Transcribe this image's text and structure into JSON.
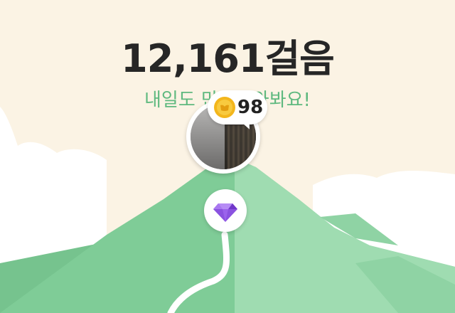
{
  "summary": {
    "steps_label": "12,161걸음",
    "message": "내일도 만나러와봐요!"
  },
  "reward": {
    "coin_count": "98",
    "coin_icon": "coin-icon",
    "gem_icon": "diamond-icon"
  },
  "colors": {
    "background": "#fbf3e4",
    "mountain": "#7fcc97",
    "accent_text": "#5fb97f",
    "gem": "#8a52e0",
    "coin": "#f3b61c"
  }
}
